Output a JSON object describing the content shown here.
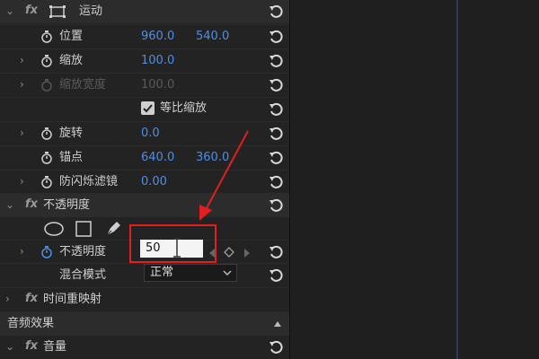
{
  "panel": {
    "motion": {
      "label": "运动"
    },
    "position": {
      "label": "位置",
      "x": "960.0",
      "y": "540.0"
    },
    "scale": {
      "label": "缩放",
      "value": "100.0"
    },
    "scale_width": {
      "label": "缩放宽度",
      "value": "100.0"
    },
    "uniform_scale": {
      "label": "等比缩放",
      "checked": true
    },
    "rotation": {
      "label": "旋转",
      "value": "0.0"
    },
    "anchor": {
      "label": "锚点",
      "x": "640.0",
      "y": "360.0"
    },
    "antiflicker": {
      "label": "防闪烁滤镜",
      "value": "0.00"
    },
    "opacity": {
      "label": "不透明度",
      "prop_label": "不透明度",
      "value": "50"
    },
    "blend_mode": {
      "label": "混合模式",
      "value": "正常"
    },
    "time_remap": {
      "label": "时间重映射"
    },
    "audio_effects": {
      "label": "音频效果"
    },
    "volume": {
      "label": "音量"
    }
  },
  "fx_label": "fx",
  "colors": {
    "accent": "#4d8ee6",
    "highlight": "#e02020",
    "panel": "#232323"
  }
}
